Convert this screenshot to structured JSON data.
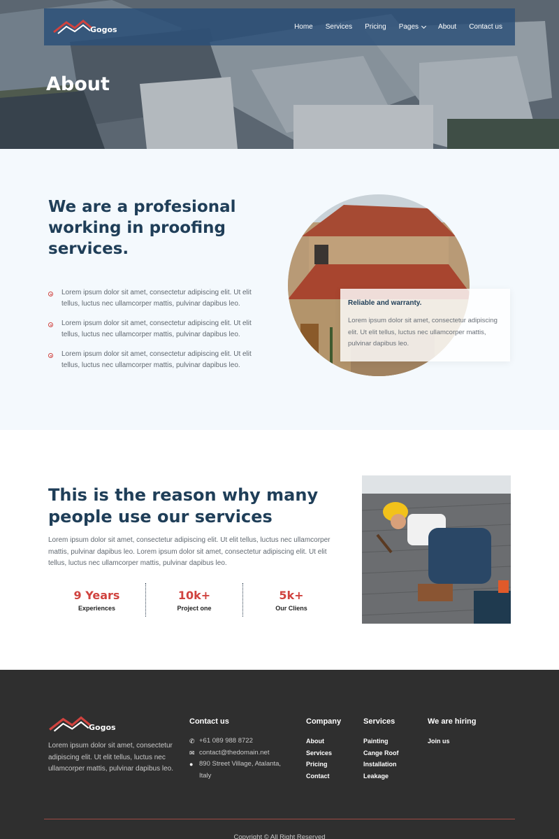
{
  "brand": {
    "name": "Gogos",
    "accent": "#d0433f",
    "navy": "#1f3e58"
  },
  "nav": {
    "items": [
      "Home",
      "Services",
      "Pricing",
      "Pages",
      "About",
      "Contact us"
    ]
  },
  "hero": {
    "title": "About"
  },
  "about": {
    "heading": "We are a profesional working in proofing services.",
    "bullets": [
      "Lorem ipsum dolor sit amet, consectetur adipiscing elit. Ut elit tellus, luctus nec ullamcorper mattis, pulvinar dapibus leo.",
      "Lorem ipsum dolor sit amet, consectetur adipiscing elit. Ut elit tellus, luctus nec ullamcorper mattis, pulvinar dapibus leo.",
      "Lorem ipsum dolor sit amet, consectetur adipiscing elit. Ut elit tellus, luctus nec ullamcorper mattis, pulvinar dapibus leo."
    ],
    "card": {
      "title": "Reliable and warranty.",
      "text": "Lorem ipsum dolor sit amet, consectetur adipiscing elit. Ut elit tellus, luctus nec ullamcorper mattis, pulvinar dapibus leo."
    }
  },
  "reason": {
    "heading": "This is the reason why many people use our services",
    "paragraph": "Lorem ipsum dolor sit amet, consectetur adipiscing elit. Ut elit tellus, luctus nec ullamcorper mattis, pulvinar dapibus leo. Lorem ipsum dolor sit amet, consectetur adipiscing elit. Ut elit tellus, luctus nec ullamcorper mattis, pulvinar dapibus leo.",
    "stats": [
      {
        "value": "9 Years",
        "label": "Experiences"
      },
      {
        "value": "10k+",
        "label": "Project one"
      },
      {
        "value": "5k+",
        "label": "Our Cliens"
      }
    ]
  },
  "footer": {
    "about": "Lorem ipsum dolor sit amet, consectetur adipiscing elit. Ut elit tellus, luctus nec ullamcorper mattis, pulvinar dapibus leo.",
    "contact": {
      "title": "Contact us",
      "phone": "+61 089 988 8722",
      "email": "contact@thedomain.net",
      "address": "890 Street Village, Atalanta, Italy"
    },
    "company": {
      "title": "Company",
      "links": [
        "About",
        "Services",
        "Pricing",
        "Contact"
      ]
    },
    "services": {
      "title": "Services",
      "links": [
        "Painting",
        "Cange Roof",
        "Installation",
        "Leakage"
      ]
    },
    "hiring": {
      "title": "We are hiring",
      "links": [
        "Join us"
      ]
    },
    "copyright": "Copyright © All Right Reserved"
  }
}
